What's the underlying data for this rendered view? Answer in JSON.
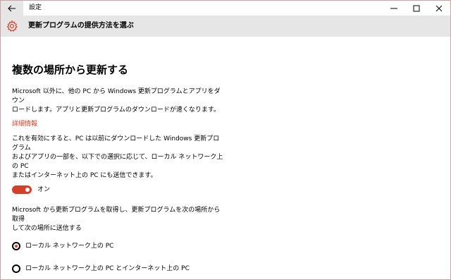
{
  "window": {
    "app_title": "設定",
    "accent_color": "#d2402a",
    "header_bg": "#e6e6e6"
  },
  "header": {
    "title": "更新プログラムの提供方法を選ぶ",
    "icon": "gear-icon"
  },
  "section": {
    "title": "複数の場所から更新する",
    "intro_line1": "Microsoft 以外に、他の PC から Windows 更新プログラムとアプリをダウン",
    "intro_line2": "ロードします。アプリと更新プログラムのダウンロードが速くなります。",
    "link_label": "詳細情報",
    "desc_line1": "これを有効にすると、PC は以前にダウンロードした Windows 更新プログラム",
    "desc_line2": "およびアプリの一部を、以下での選択に応じて、ローカル ネットワーク上の PC",
    "desc_line3": "またはインターネット上の PC にも送信できます。",
    "toggle_label": "オン",
    "toggle_on": true,
    "choice_line1": "Microsoft から更新プログラムを取得し、更新プログラムを次の場所から取得",
    "choice_line2": "して次の場所に送信する",
    "options": [
      {
        "label": "ローカル ネットワーク上の PC",
        "selected": true
      },
      {
        "label": "ローカル ネットワーク上の PC とインターネット上の PC",
        "selected": false
      }
    ]
  }
}
